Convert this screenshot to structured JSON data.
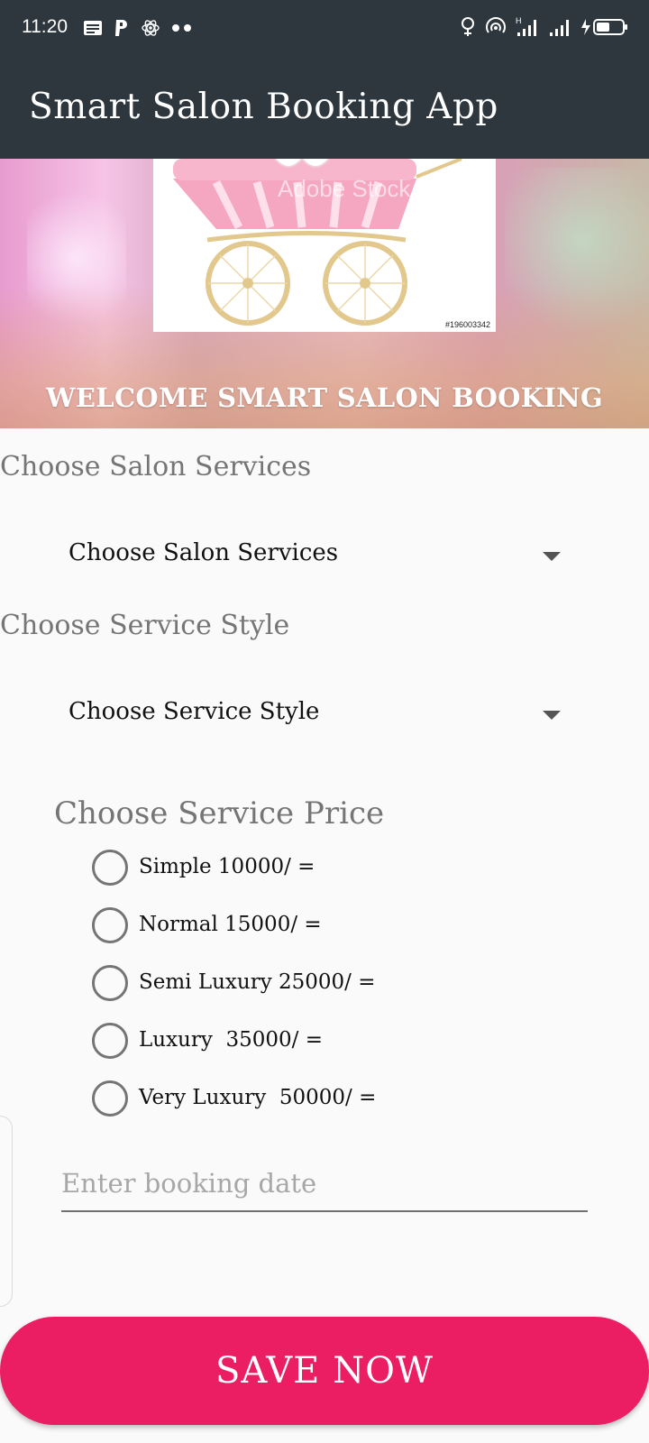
{
  "status_bar": {
    "time": "11:20",
    "network_label": "H"
  },
  "app_bar": {
    "title": "Smart Salon Booking App"
  },
  "banner": {
    "stock_watermark": "Adobe Stock",
    "stock_id": "#196003342",
    "welcome_text": "WELCOME SMART SALON BOOKING"
  },
  "services": {
    "label": "Choose Salon Services",
    "selected": "Choose Salon Services"
  },
  "style": {
    "label": "Choose Service Style",
    "selected": "Choose Service Style"
  },
  "price": {
    "label": "Choose Service Price",
    "options": [
      "Simple 10000/ =",
      "Normal 15000/ =",
      "Semi Luxury 25000/ =",
      "Luxury  35000/ =",
      "Very Luxury  50000/ ="
    ]
  },
  "booking_date": {
    "placeholder": "Enter booking date",
    "value": ""
  },
  "save_button": {
    "label": "SAVE NOW"
  },
  "colors": {
    "app_bar": "#2e373d",
    "accent": "#ec1e63",
    "label_gray": "#757575",
    "background": "#fafafa"
  }
}
